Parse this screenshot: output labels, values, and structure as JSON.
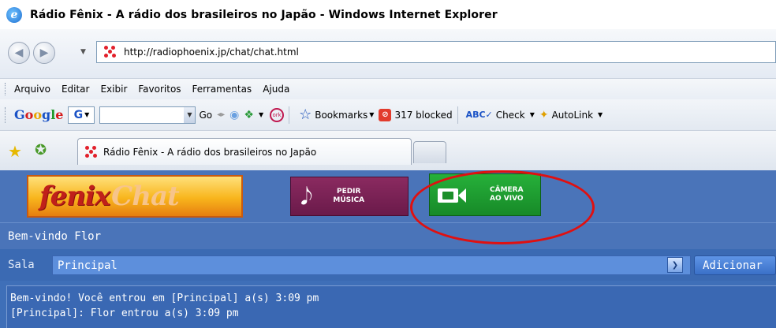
{
  "window": {
    "title": "Rádio Fênix - A rádio dos brasileiros no Japão - Windows Internet Explorer"
  },
  "address": {
    "url": "http://radiophoenix.jp/chat/chat.html"
  },
  "menu": {
    "items": [
      "Arquivo",
      "Editar",
      "Exibir",
      "Favoritos",
      "Ferramentas",
      "Ajuda"
    ]
  },
  "google_toolbar": {
    "logo_parts": [
      "G",
      "o",
      "o",
      "g",
      "l",
      "e"
    ],
    "g_button": "G",
    "go_label": "Go",
    "bookmarks_label": "Bookmarks",
    "blocked_label": "317 blocked",
    "check_label": "Check",
    "autolink_label": "AutoLink"
  },
  "tabs": [
    {
      "title": "Rádio Fênix - A rádio dos brasileiros no Japão"
    }
  ],
  "page": {
    "logo": {
      "part1": "fenix",
      "part2": "Chat"
    },
    "pedir_button": {
      "line1": "PEDIR",
      "line2": "MÚSICA"
    },
    "camera_button": {
      "line1": "CÂMERA",
      "line2": "AO VIVO"
    },
    "welcome_text": "Bem-vindo Flor",
    "room": {
      "label": "Sala",
      "selected": "Principal",
      "add_button": "Adicionar"
    },
    "chat_lines": [
      "Bem-vindo! Você entrou em [Principal] a(s) 3:09 pm",
      "[Principal]: Flor entrou a(s) 3:09 pm"
    ]
  },
  "colors": {
    "page_bg": "#3f6fb8",
    "annotation": "#e01010",
    "camera_button": "#1f9e33",
    "pedir_button": "#7a2256"
  }
}
